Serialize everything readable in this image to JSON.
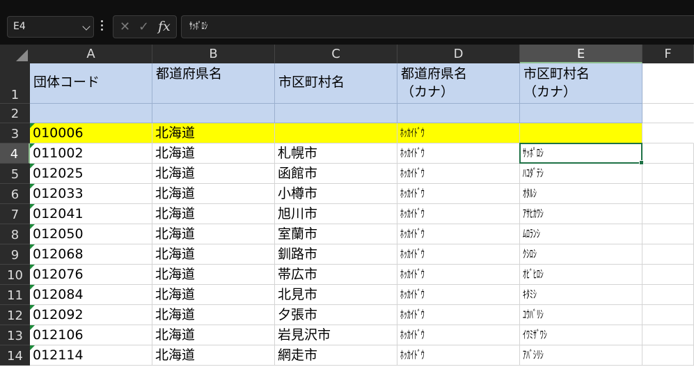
{
  "formula_bar": {
    "name_box": "E4",
    "cancel_icon": "✕",
    "enter_icon": "✓",
    "function_icon": "fx",
    "formula": "ｻｯﾎﾟﾛｼ"
  },
  "column_headers": [
    "A",
    "B",
    "C",
    "D",
    "E",
    "F"
  ],
  "selected_column": "E",
  "selected_row": "4",
  "header_row": [
    "団体コード",
    "都道府県名",
    "市区町村名",
    "都道府県名\n（カナ）",
    "市区町村名\n（カナ）"
  ],
  "rows": [
    {
      "num": "1"
    },
    {
      "num": "2",
      "cells": [
        "",
        "",
        "",
        "",
        ""
      ]
    },
    {
      "num": "3",
      "cells": [
        "010006",
        "北海道",
        "",
        "ﾎｯｶｲﾄﾞｳ",
        ""
      ]
    },
    {
      "num": "4",
      "cells": [
        "011002",
        "北海道",
        "札幌市",
        "ﾎｯｶｲﾄﾞｳ",
        "ｻｯﾎﾟﾛｼ"
      ]
    },
    {
      "num": "5",
      "cells": [
        "012025",
        "北海道",
        "函館市",
        "ﾎｯｶｲﾄﾞｳ",
        "ﾊｺﾀﾞﾃｼ"
      ]
    },
    {
      "num": "6",
      "cells": [
        "012033",
        "北海道",
        "小樽市",
        "ﾎｯｶｲﾄﾞｳ",
        "ｵﾀﾙｼ"
      ]
    },
    {
      "num": "7",
      "cells": [
        "012041",
        "北海道",
        "旭川市",
        "ﾎｯｶｲﾄﾞｳ",
        "ｱｻﾋｶﾜｼ"
      ]
    },
    {
      "num": "8",
      "cells": [
        "012050",
        "北海道",
        "室蘭市",
        "ﾎｯｶｲﾄﾞｳ",
        "ﾑﾛﾗﾝｼ"
      ]
    },
    {
      "num": "9",
      "cells": [
        "012068",
        "北海道",
        "釧路市",
        "ﾎｯｶｲﾄﾞｳ",
        "ｸｼﾛｼ"
      ]
    },
    {
      "num": "10",
      "cells": [
        "012076",
        "北海道",
        "帯広市",
        "ﾎｯｶｲﾄﾞｳ",
        "ｵﾋﾞﾋﾛｼ"
      ]
    },
    {
      "num": "11",
      "cells": [
        "012084",
        "北海道",
        "北見市",
        "ﾎｯｶｲﾄﾞｳ",
        "ｷﾀﾐｼ"
      ]
    },
    {
      "num": "12",
      "cells": [
        "012092",
        "北海道",
        "夕張市",
        "ﾎｯｶｲﾄﾞｳ",
        "ﾕｳﾊﾞﾘｼ"
      ]
    },
    {
      "num": "13",
      "cells": [
        "012106",
        "北海道",
        "岩見沢市",
        "ﾎｯｶｲﾄﾞｳ",
        "ｲﾜﾐｻﾞﾜｼ"
      ]
    },
    {
      "num": "14",
      "cells": [
        "012114",
        "北海道",
        "網走市",
        "ﾎｯｶｲﾄﾞｳ",
        "ｱﾊﾞｼﾘｼ"
      ]
    }
  ],
  "colors": {
    "header_fill": "#c5d6ef",
    "highlight_fill": "#ffff00",
    "selection": "#1e7145",
    "error_indicator": "#1d8a3a"
  }
}
